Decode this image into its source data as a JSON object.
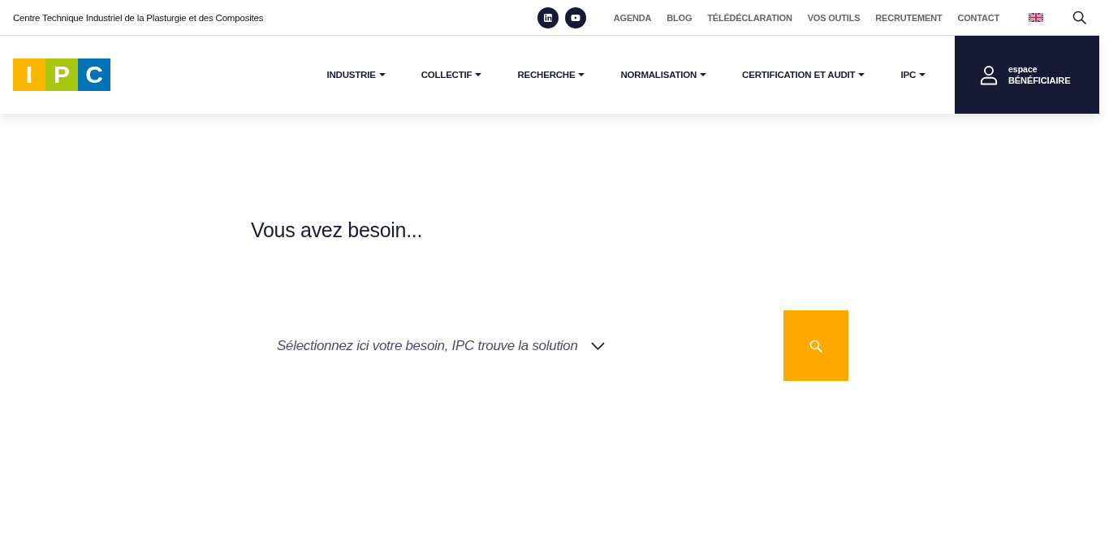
{
  "top_bar": {
    "tagline": "Centre Technique Industriel de la Plasturgie et des Composites",
    "links": [
      "AGENDA",
      "BLOG",
      "TÉLÉDÉCLARATION",
      "VOS OUTILS",
      "RECRUTEMENT",
      "CONTACT"
    ]
  },
  "header": {
    "logo": [
      {
        "letter": "I",
        "color": "#fbb800"
      },
      {
        "letter": "P",
        "color": "#a8c80f"
      },
      {
        "letter": "C",
        "color": "#0073b6"
      }
    ],
    "nav": [
      {
        "label": "INDUSTRIE",
        "dropdown": true
      },
      {
        "label": "COLLECTIF",
        "dropdown": true
      },
      {
        "label": "RECHERCHE",
        "dropdown": true
      },
      {
        "label": "NORMALISATION",
        "dropdown": true
      },
      {
        "label": "CERTIFICATION ET AUDIT",
        "dropdown": true
      },
      {
        "label": "IPC",
        "dropdown": true
      }
    ],
    "account": {
      "prefix": "espace",
      "label": "BÉNÉFICIAIRE"
    }
  },
  "search_panel": {
    "heading": "Vous avez besoin...",
    "select": {
      "placeholder": "Sélectionnez ici votre besoin, IPC trouve la solution"
    }
  }
}
